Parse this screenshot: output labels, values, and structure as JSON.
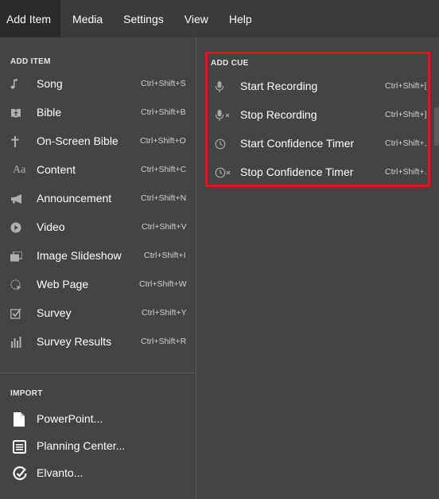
{
  "menubar": {
    "items": [
      "Add Item",
      "Media",
      "Settings",
      "View",
      "Help"
    ]
  },
  "add_item": {
    "title": "ADD ITEM",
    "items": [
      {
        "label": "Song",
        "shortcut": "Ctrl+Shift+S",
        "icon": "music-note-icon"
      },
      {
        "label": "Bible",
        "shortcut": "Ctrl+Shift+B",
        "icon": "bible-icon"
      },
      {
        "label": "On-Screen Bible",
        "shortcut": "Ctrl+Shift+O",
        "icon": "cross-icon"
      },
      {
        "label": "Content",
        "shortcut": "Ctrl+Shift+C",
        "icon": "text-aa-icon"
      },
      {
        "label": "Announcement",
        "shortcut": "Ctrl+Shift+N",
        "icon": "megaphone-icon"
      },
      {
        "label": "Video",
        "shortcut": "Ctrl+Shift+V",
        "icon": "play-circle-icon"
      },
      {
        "label": "Image Slideshow",
        "shortcut": "Ctrl+Shift+I",
        "icon": "image-stack-icon"
      },
      {
        "label": "Web Page",
        "shortcut": "Ctrl+Shift+W",
        "icon": "globe-cursor-icon"
      },
      {
        "label": "Survey",
        "shortcut": "Ctrl+Shift+Y",
        "icon": "checkbox-icon"
      },
      {
        "label": "Survey Results",
        "shortcut": "Ctrl+Shift+R",
        "icon": "bar-chart-icon"
      }
    ]
  },
  "import": {
    "title": "IMPORT",
    "items": [
      {
        "label": "PowerPoint...",
        "icon": "file-icon"
      },
      {
        "label": "Planning Center...",
        "icon": "list-document-icon"
      },
      {
        "label": "Elvanto...",
        "icon": "elvanto-icon"
      }
    ]
  },
  "add_cue": {
    "title": "ADD CUE",
    "items": [
      {
        "label": "Start Recording",
        "shortcut": "Ctrl+Shift+[",
        "icon": "microphone-icon"
      },
      {
        "label": "Stop Recording",
        "shortcut": "Ctrl+Shift+]",
        "icon": "microphone-off-icon"
      },
      {
        "label": "Start Confidence Timer",
        "shortcut": "Ctrl+Shift+,",
        "icon": "clock-icon"
      },
      {
        "label": "Stop Confidence Timer",
        "shortcut": "Ctrl+Shift+.",
        "icon": "clock-off-icon"
      }
    ]
  },
  "colors": {
    "background": "#444444",
    "menubar": "#3b3b3b",
    "active_menu": "#2a2a2a",
    "highlight_border": "#e0161c"
  }
}
